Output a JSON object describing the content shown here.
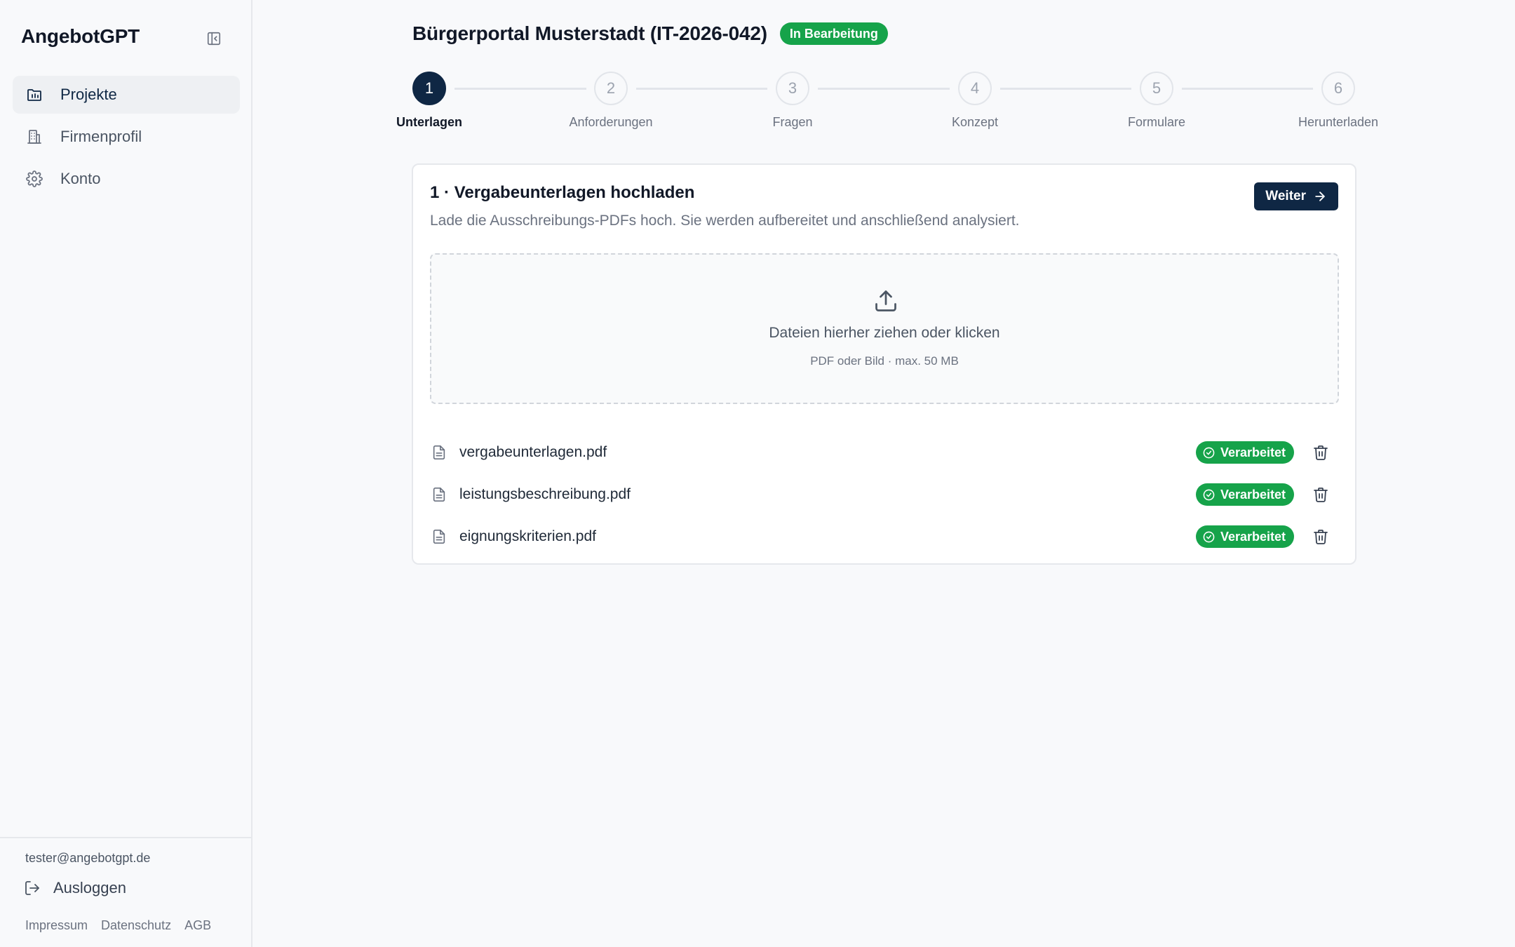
{
  "app": {
    "name": "AngebotGPT"
  },
  "sidebar": {
    "items": [
      {
        "label": "Projekte",
        "icon": "folder-chart-icon",
        "active": true
      },
      {
        "label": "Firmenprofil",
        "icon": "building-icon",
        "active": false
      },
      {
        "label": "Konto",
        "icon": "gear-icon",
        "active": false
      }
    ],
    "user_email": "tester@angebotgpt.de",
    "logout_label": "Ausloggen",
    "legal": [
      "Impressum",
      "Datenschutz",
      "AGB"
    ]
  },
  "project": {
    "title": "Bürgerportal Musterstadt (IT-2026-042)",
    "status": "In Bearbeitung"
  },
  "stepper": {
    "current": 1,
    "steps": [
      {
        "number": "1",
        "label": "Unterlagen"
      },
      {
        "number": "2",
        "label": "Anforderungen"
      },
      {
        "number": "3",
        "label": "Fragen"
      },
      {
        "number": "4",
        "label": "Konzept"
      },
      {
        "number": "5",
        "label": "Formulare"
      },
      {
        "number": "6",
        "label": "Herunterladen"
      }
    ]
  },
  "card": {
    "title": "1 · Vergabeunterlagen hochladen",
    "subtitle": "Lade die Ausschreibungs-PDFs hoch. Sie werden aufbereitet und anschließend analysiert.",
    "next_label": "Weiter",
    "dropzone": {
      "main": "Dateien hierher ziehen oder klicken",
      "hint": "PDF oder Bild · max. 50 MB"
    },
    "files": [
      {
        "name": "vergabeunterlagen.pdf",
        "status": "Verarbeitet"
      },
      {
        "name": "leistungsbeschreibung.pdf",
        "status": "Verarbeitet"
      },
      {
        "name": "eignungskriterien.pdf",
        "status": "Verarbeitet"
      }
    ]
  },
  "colors": {
    "primary": "#0f2744",
    "success": "#16a34a",
    "background": "#f8f9fb",
    "border": "#e6e8ec"
  }
}
